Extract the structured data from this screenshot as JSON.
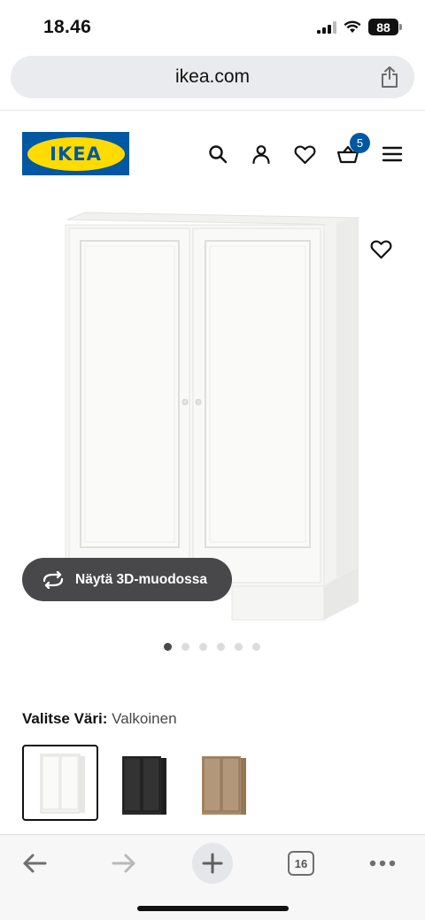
{
  "status_bar": {
    "time": "18.46",
    "battery": "88"
  },
  "browser": {
    "url": "ikea.com",
    "tab_count": "16"
  },
  "header": {
    "logo_text": "IKEA",
    "cart_count": "5",
    "icons": [
      "search-icon",
      "user-icon",
      "heart-icon",
      "basket-icon",
      "menu-icon"
    ]
  },
  "product": {
    "view_3d_label": "Näytä 3D-muodossa",
    "image_count": 6,
    "active_image_index": 0
  },
  "color_selector": {
    "label": "Valitse Väri:",
    "selected_value": "Valkoinen",
    "options": [
      {
        "name": "white",
        "color": "#f4f4f2"
      },
      {
        "name": "black",
        "color": "#2a2a2a"
      },
      {
        "name": "oak",
        "color": "#a88a6a"
      }
    ]
  },
  "colors": {
    "ikea_blue": "#0058a3",
    "ikea_yellow": "#ffdb00"
  }
}
